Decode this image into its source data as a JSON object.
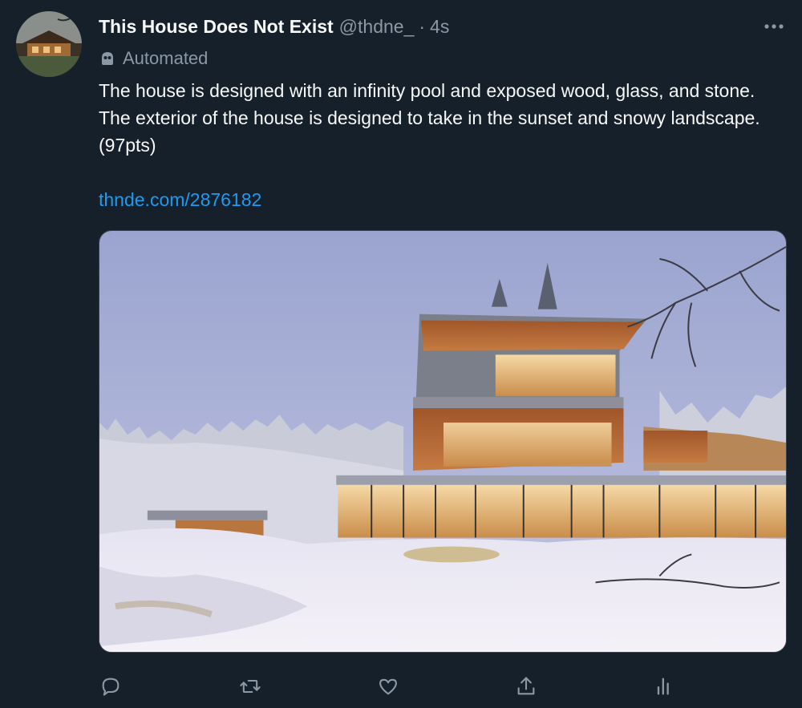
{
  "tweet": {
    "display_name": "This House Does Not Exist",
    "handle": "@thdne_",
    "separator": "·",
    "time": "4s",
    "automated_label": "Automated",
    "text": "The house is designed with an infinity pool and exposed wood, glass, and stone. The exterior of the house is designed to take in the sunset and snowy landscape. (97pts)",
    "link": "thnde.com/2876182"
  },
  "icons": {
    "more": "more-horizontal-icon",
    "automated": "robot-icon",
    "reply": "reply-icon",
    "retweet": "retweet-icon",
    "like": "heart-icon",
    "share": "share-icon",
    "analytics": "analytics-icon"
  },
  "colors": {
    "background": "#15202b",
    "text": "#f7f9f9",
    "secondary_text": "#8b98a5",
    "link": "#1d9bf0",
    "border": "#38444d"
  }
}
